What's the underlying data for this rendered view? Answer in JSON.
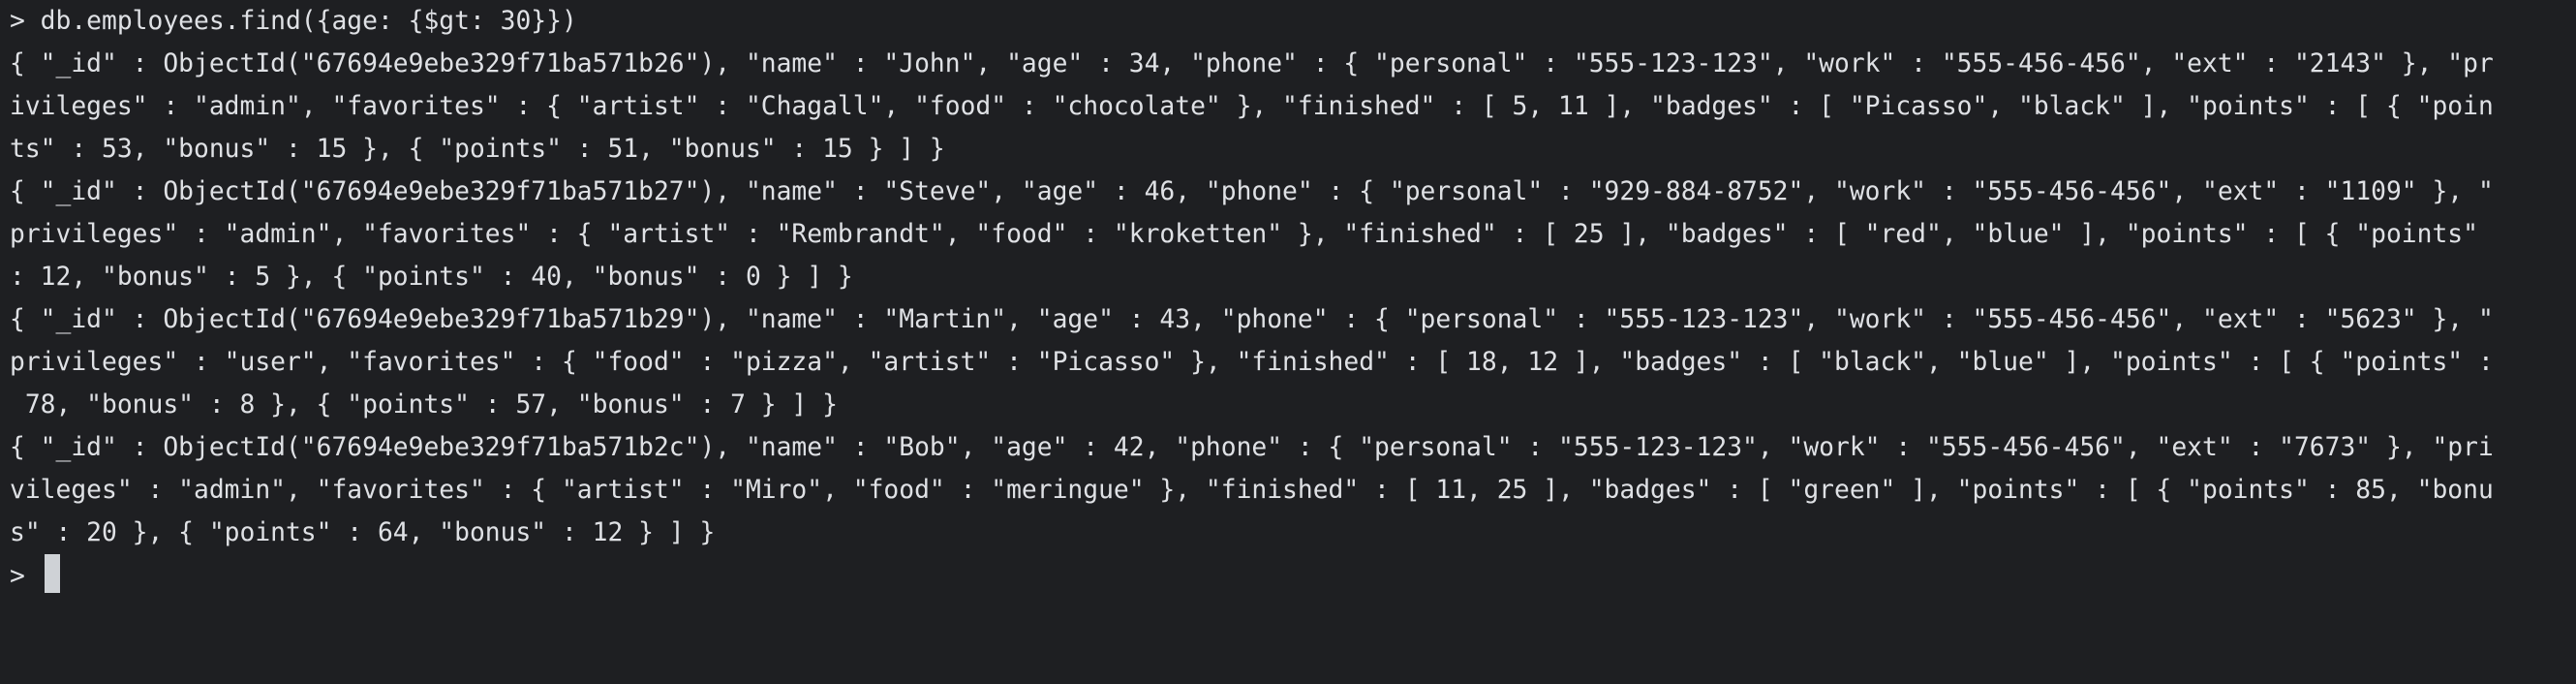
{
  "terminal": {
    "command_line": "> db.employees.find({age: {$gt: 30}})",
    "output_lines": [
      "{ \"_id\" : ObjectId(\"67694e9ebe329f71ba571b26\"), \"name\" : \"John\", \"age\" : 34, \"phone\" : { \"personal\" : \"555-123-123\", \"work\" : \"555-456-456\", \"ext\" : \"2143\" }, \"pr",
      "ivileges\" : \"admin\", \"favorites\" : { \"artist\" : \"Chagall\", \"food\" : \"chocolate\" }, \"finished\" : [ 5, 11 ], \"badges\" : [ \"Picasso\", \"black\" ], \"points\" : [ { \"poin",
      "ts\" : 53, \"bonus\" : 15 }, { \"points\" : 51, \"bonus\" : 15 } ] }",
      "{ \"_id\" : ObjectId(\"67694e9ebe329f71ba571b27\"), \"name\" : \"Steve\", \"age\" : 46, \"phone\" : { \"personal\" : \"929-884-8752\", \"work\" : \"555-456-456\", \"ext\" : \"1109\" }, \"",
      "privileges\" : \"admin\", \"favorites\" : { \"artist\" : \"Rembrandt\", \"food\" : \"kroketten\" }, \"finished\" : [ 25 ], \"badges\" : [ \"red\", \"blue\" ], \"points\" : [ { \"points\"",
      ": 12, \"bonus\" : 5 }, { \"points\" : 40, \"bonus\" : 0 } ] }",
      "{ \"_id\" : ObjectId(\"67694e9ebe329f71ba571b29\"), \"name\" : \"Martin\", \"age\" : 43, \"phone\" : { \"personal\" : \"555-123-123\", \"work\" : \"555-456-456\", \"ext\" : \"5623\" }, \"",
      "privileges\" : \"user\", \"favorites\" : { \"food\" : \"pizza\", \"artist\" : \"Picasso\" }, \"finished\" : [ 18, 12 ], \"badges\" : [ \"black\", \"blue\" ], \"points\" : [ { \"points\" :",
      " 78, \"bonus\" : 8 }, { \"points\" : 57, \"bonus\" : 7 } ] }",
      "{ \"_id\" : ObjectId(\"67694e9ebe329f71ba571b2c\"), \"name\" : \"Bob\", \"age\" : 42, \"phone\" : { \"personal\" : \"555-123-123\", \"work\" : \"555-456-456\", \"ext\" : \"7673\" }, \"pri",
      "vileges\" : \"admin\", \"favorites\" : { \"artist\" : \"Miro\", \"food\" : \"meringue\" }, \"finished\" : [ 11, 25 ], \"badges\" : [ \"green\" ], \"points\" : [ { \"points\" : 85, \"bonu",
      "s\" : 20 }, { \"points\" : 64, \"bonus\" : 12 } ] }"
    ],
    "prompt": "> "
  },
  "colors": {
    "background": "#1e1f22",
    "foreground": "#dfe1e5",
    "cursor": "#cfd2d6"
  }
}
